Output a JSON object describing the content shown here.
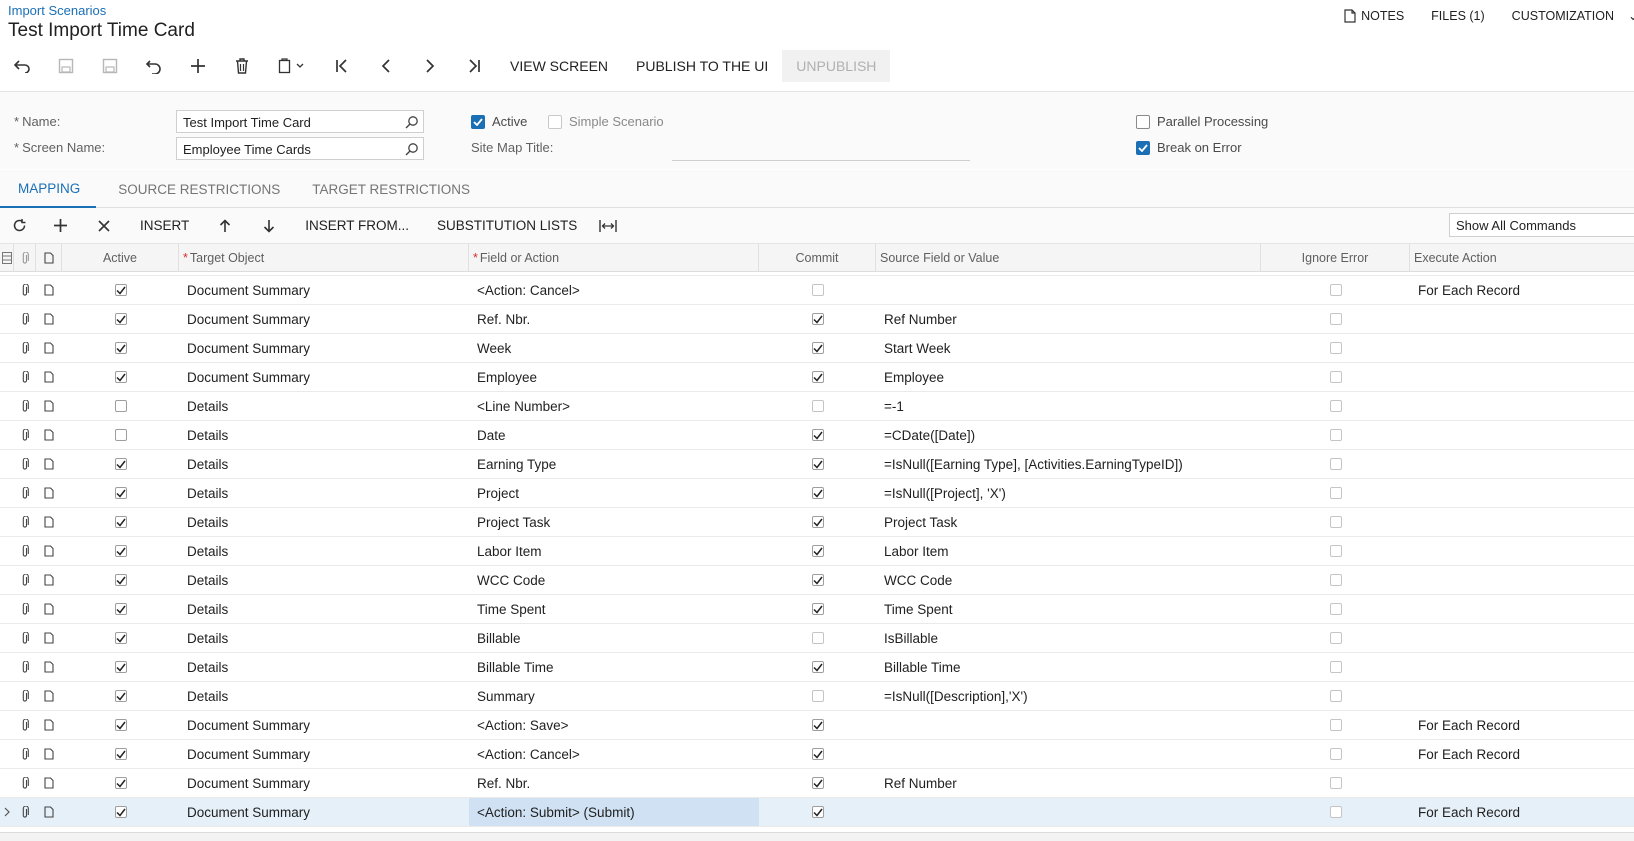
{
  "breadcrumb": "Import Scenarios",
  "title": "Test Import Time Card",
  "top_actions": {
    "notes": "NOTES",
    "files": "FILES (1)",
    "customization": "CUSTOMIZATION"
  },
  "toolbar": {
    "view_screen": "VIEW SCREEN",
    "publish": "PUBLISH TO THE UI",
    "unpublish": "UNPUBLISH"
  },
  "form": {
    "name_label": "Name:",
    "name_value": "Test Import Time Card",
    "screen_label": "Screen Name:",
    "screen_value": "Employee Time Cards",
    "active_label": "Active",
    "active_checked": true,
    "simple_label": "Simple Scenario",
    "simple_checked": false,
    "sitemap_label": "Site Map Title:",
    "parallel_label": "Parallel Processing",
    "parallel_checked": false,
    "break_label": "Break on Error",
    "break_checked": true
  },
  "tabs": [
    "MAPPING",
    "SOURCE RESTRICTIONS",
    "TARGET RESTRICTIONS"
  ],
  "grid_toolbar": {
    "insert": "INSERT",
    "insert_from": "INSERT FROM...",
    "substitution": "SUBSTITUTION LISTS",
    "commands_select": "Show All Commands"
  },
  "columns": {
    "active": "Active",
    "target": "Target Object",
    "field": "Field or Action",
    "commit": "Commit",
    "source": "Source Field or Value",
    "ignore": "Ignore Error",
    "execute": "Execute Action"
  },
  "rows": [
    {
      "active": true,
      "target": "Document Summary",
      "field": "<Action: Cancel>",
      "commit": false,
      "source": "",
      "ignore": false,
      "execute": "For Each Record"
    },
    {
      "active": true,
      "target": "Document Summary",
      "field": "Ref. Nbr.",
      "commit": true,
      "source": "Ref Number",
      "ignore": false,
      "execute": ""
    },
    {
      "active": true,
      "target": "Document Summary",
      "field": "Week",
      "commit": true,
      "source": "Start Week",
      "ignore": false,
      "execute": ""
    },
    {
      "active": true,
      "target": "Document Summary",
      "field": "Employee",
      "commit": true,
      "source": "Employee",
      "ignore": false,
      "execute": ""
    },
    {
      "active": false,
      "target": "Details",
      "field": "<Line Number>",
      "commit": false,
      "source": "=-1",
      "ignore": false,
      "execute": ""
    },
    {
      "active": false,
      "target": "Details",
      "field": "Date",
      "commit": true,
      "source": "=CDate([Date])",
      "ignore": false,
      "execute": ""
    },
    {
      "active": true,
      "target": "Details",
      "field": "Earning Type",
      "commit": true,
      "source": "=IsNull([Earning Type], [Activities.EarningTypeID])",
      "ignore": false,
      "execute": ""
    },
    {
      "active": true,
      "target": "Details",
      "field": "Project",
      "commit": true,
      "source": "=IsNull([Project], 'X')",
      "ignore": false,
      "execute": ""
    },
    {
      "active": true,
      "target": "Details",
      "field": "Project Task",
      "commit": true,
      "source": "Project Task",
      "ignore": false,
      "execute": ""
    },
    {
      "active": true,
      "target": "Details",
      "field": "Labor Item",
      "commit": true,
      "source": "Labor Item",
      "ignore": false,
      "execute": ""
    },
    {
      "active": true,
      "target": "Details",
      "field": "WCC Code",
      "commit": true,
      "source": "WCC Code",
      "ignore": false,
      "execute": ""
    },
    {
      "active": true,
      "target": "Details",
      "field": "Time Spent",
      "commit": true,
      "source": "Time Spent",
      "ignore": false,
      "execute": ""
    },
    {
      "active": true,
      "target": "Details",
      "field": "Billable",
      "commit": false,
      "source": "IsBillable",
      "ignore": false,
      "execute": ""
    },
    {
      "active": true,
      "target": "Details",
      "field": "Billable Time",
      "commit": true,
      "source": "Billable Time",
      "ignore": false,
      "execute": ""
    },
    {
      "active": true,
      "target": "Details",
      "field": "Summary",
      "commit": false,
      "source": "=IsNull([Description],'X')",
      "ignore": false,
      "execute": ""
    },
    {
      "active": true,
      "target": "Document Summary",
      "field": "<Action: Save>",
      "commit": true,
      "source": "",
      "ignore": false,
      "execute": "For Each Record"
    },
    {
      "active": true,
      "target": "Document Summary",
      "field": "<Action: Cancel>",
      "commit": true,
      "source": "",
      "ignore": false,
      "execute": "For Each Record"
    },
    {
      "active": true,
      "target": "Document Summary",
      "field": "Ref. Nbr.",
      "commit": true,
      "source": "Ref Number",
      "ignore": false,
      "execute": ""
    },
    {
      "active": true,
      "target": "Document Summary",
      "field": "<Action: Submit> (Submit)",
      "commit": true,
      "source": "",
      "ignore": false,
      "execute": "For Each Record",
      "selected": true
    }
  ],
  "colors": {
    "accent": "#1b6fb5",
    "selected_row": "#e6f0f9"
  }
}
